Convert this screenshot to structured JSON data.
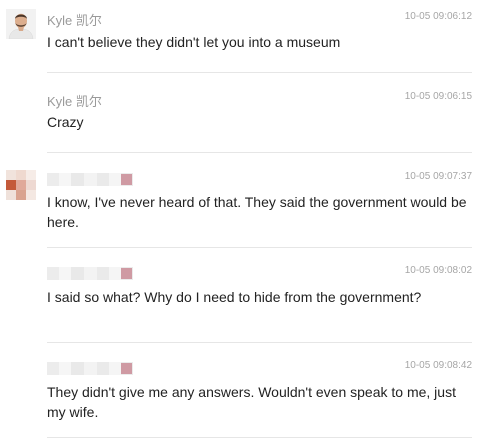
{
  "messages": [
    {
      "sender": "Kyle 凯尔",
      "time": "10-05 09:06:12",
      "text": "I can't believe they didn't let you into a museum",
      "avatar": "man-photo-avatar"
    },
    {
      "sender": "Kyle 凯尔",
      "time": "10-05 09:06:15",
      "text": "Crazy",
      "avatar": null
    },
    {
      "sender": "",
      "time": "10-05 09:07:37",
      "text": "I know, I've never heard of that. They said the government would be here.",
      "avatar": "pixelated-avatar"
    },
    {
      "sender": "",
      "time": "10-05 09:08:02",
      "text": "I said so what? Why do I need to hide from the government?",
      "avatar": null
    },
    {
      "sender": "",
      "time": "10-05 09:08:42",
      "text": "They didn't give me any answers. Wouldn't even speak to me, just my wife.",
      "avatar": null
    }
  ],
  "colors": {
    "sender": "#9a9a9a",
    "time": "#a6a6a6",
    "text": "#222222",
    "divider": "#e6e6e6"
  }
}
